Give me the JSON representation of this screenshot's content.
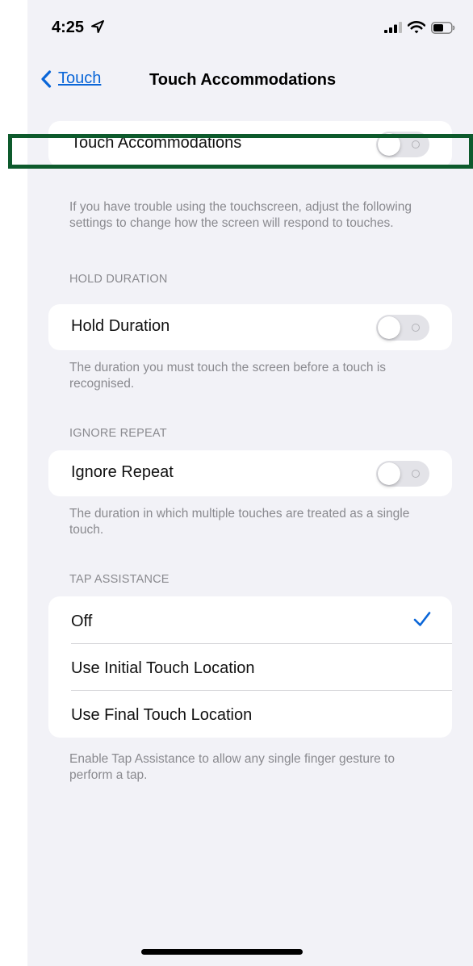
{
  "status_bar": {
    "time": "4:25",
    "icons": [
      "location-arrow-icon",
      "cellular-signal-icon",
      "wifi-icon",
      "battery-icon"
    ]
  },
  "nav": {
    "back_label": "Touch",
    "title": "Touch Accommodations"
  },
  "touch_accommodations": {
    "label": "Touch Accommodations",
    "enabled": false,
    "footer": "If you have trouble using the touchscreen, adjust the following settings to change how the screen will respond to touches."
  },
  "hold_duration": {
    "header": "HOLD DURATION",
    "label": "Hold Duration",
    "enabled": false,
    "footer": "The duration you must touch the screen before a touch is recognised."
  },
  "ignore_repeat": {
    "header": "IGNORE REPEAT",
    "label": "Ignore Repeat",
    "enabled": false,
    "footer": "The duration in which multiple touches are treated as a single touch."
  },
  "tap_assistance": {
    "header": "TAP ASSISTANCE",
    "options": [
      {
        "label": "Off",
        "selected": true
      },
      {
        "label": "Use Initial Touch Location",
        "selected": false
      },
      {
        "label": "Use Final Touch Location",
        "selected": false
      }
    ],
    "footer": "Enable Tap Assistance to allow any single finger gesture to perform a tap."
  },
  "colors": {
    "accent": "#0a66d8",
    "highlight_border": "#0d5a2c",
    "background": "#f2f2f7"
  }
}
